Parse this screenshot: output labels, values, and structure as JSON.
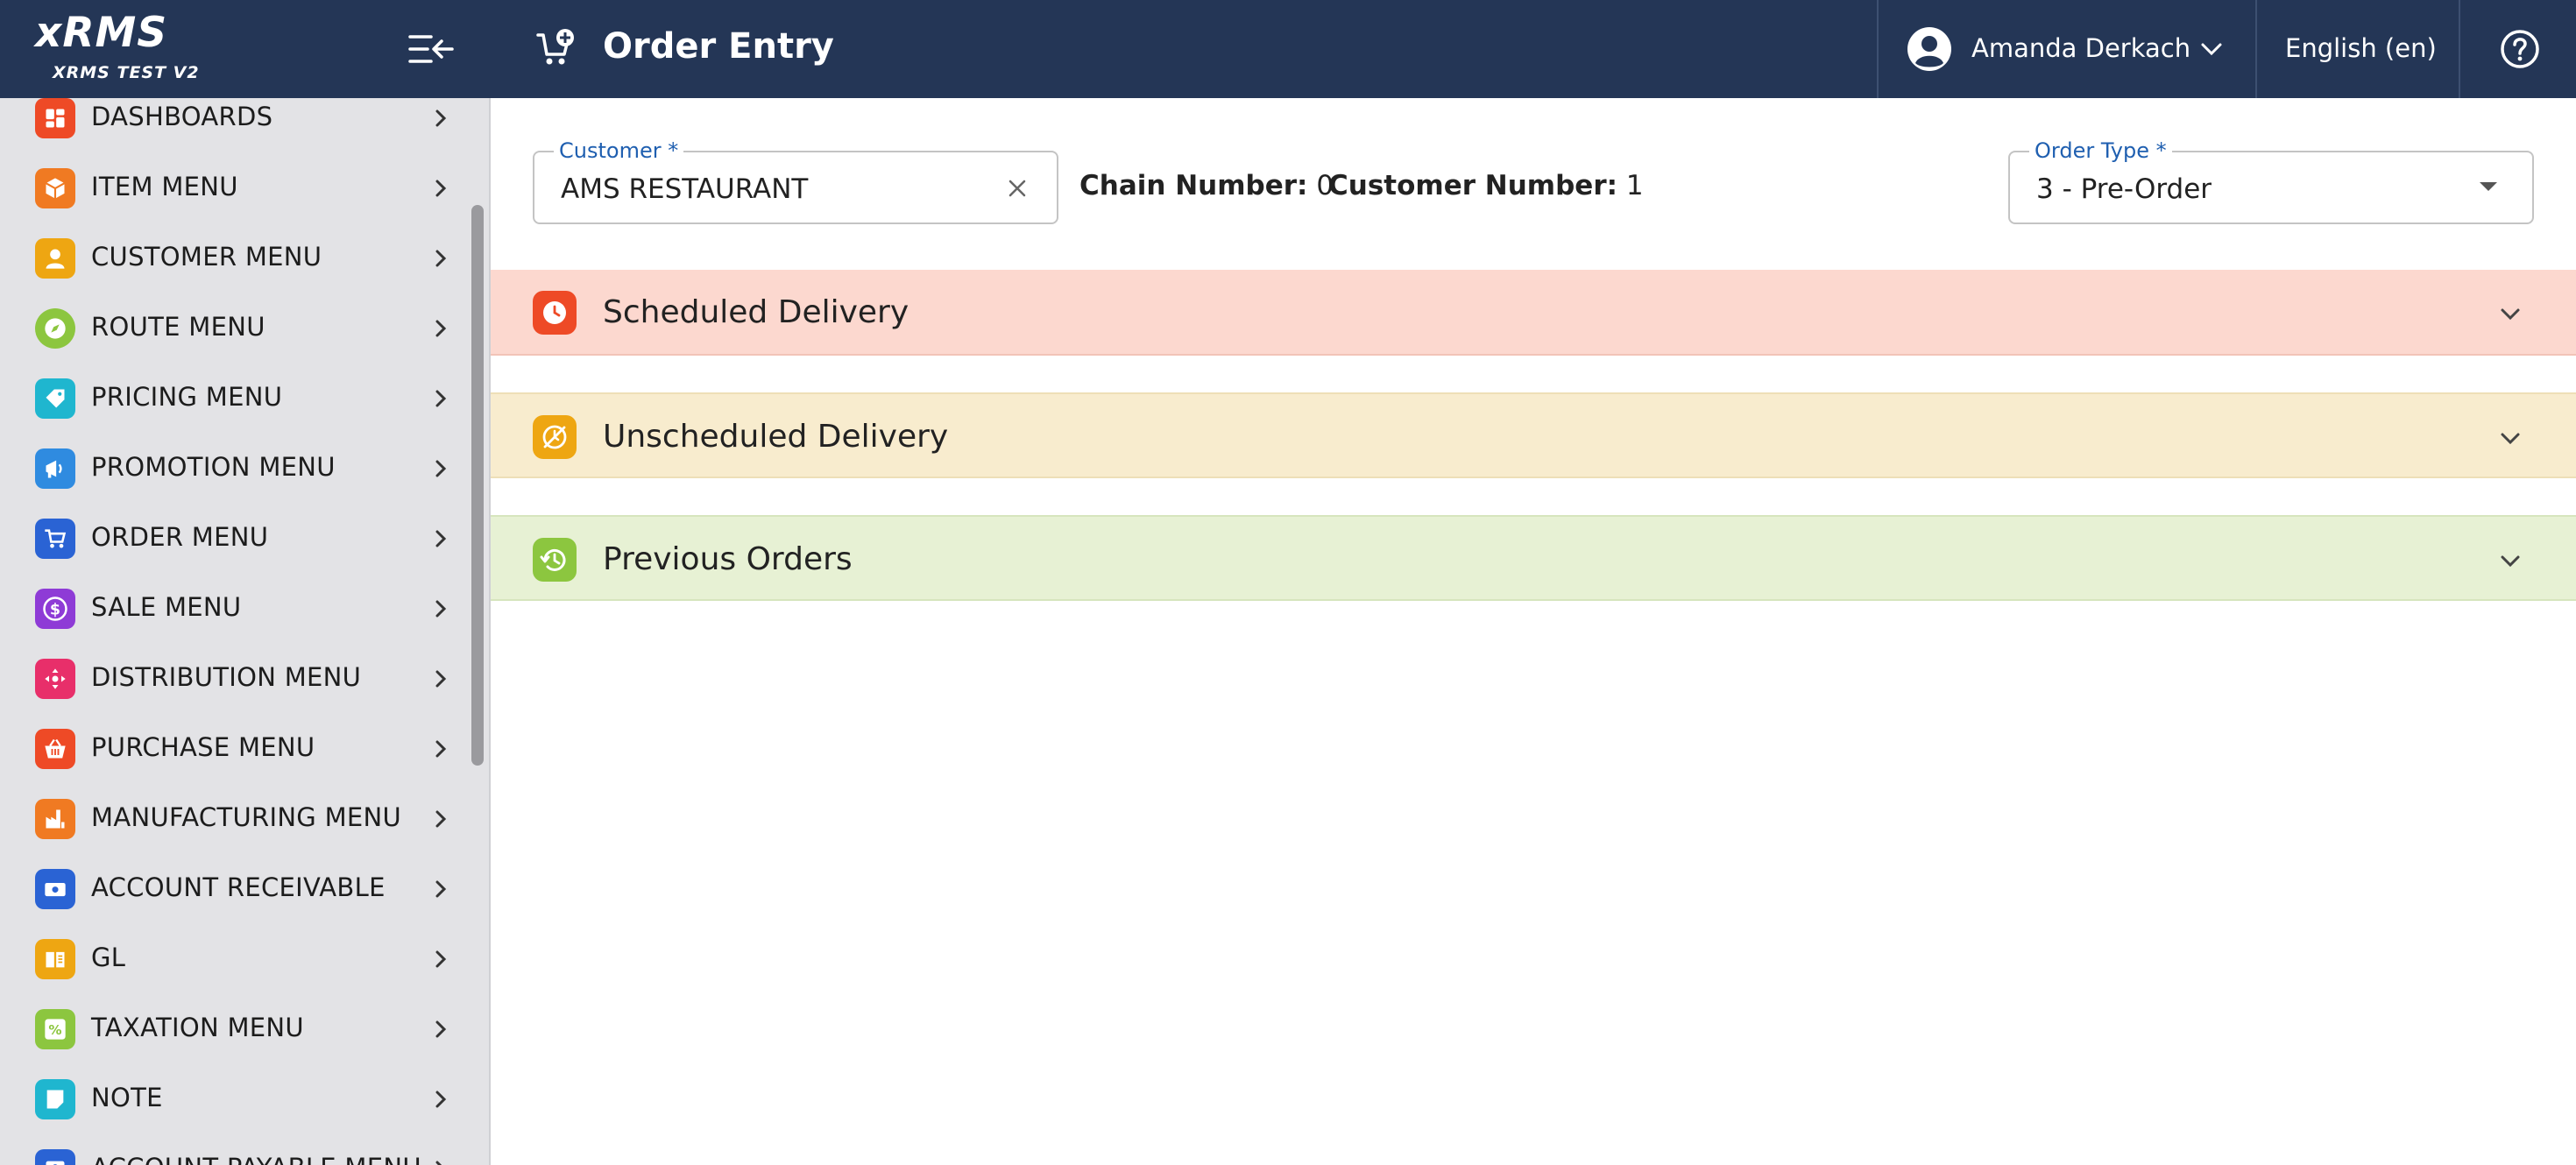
{
  "brand": {
    "title": "xRMS",
    "subtitle": "XRMS TEST V2"
  },
  "sidebar": {
    "items": [
      {
        "label": "DASHBOARDS",
        "icon": "dashboard-icon",
        "color": "#ee4a26"
      },
      {
        "label": "ITEM MENU",
        "icon": "box-icon",
        "color": "#f07a22"
      },
      {
        "label": "CUSTOMER MENU",
        "icon": "person-icon",
        "color": "#eea612"
      },
      {
        "label": "ROUTE MENU",
        "icon": "compass-icon",
        "color": "#8cc63f"
      },
      {
        "label": "PRICING MENU",
        "icon": "price-tag-icon",
        "color": "#1fb6cf"
      },
      {
        "label": "PROMOTION MENU",
        "icon": "megaphone-icon",
        "color": "#2f8be0"
      },
      {
        "label": "ORDER MENU",
        "icon": "cart-icon",
        "color": "#2a63d4"
      },
      {
        "label": "SALE MENU",
        "icon": "dollar-icon",
        "color": "#8e3bd6"
      },
      {
        "label": "DISTRIBUTION MENU",
        "icon": "distribution-icon",
        "color": "#e82f6a"
      },
      {
        "label": "PURCHASE MENU",
        "icon": "basket-icon",
        "color": "#ee4a26"
      },
      {
        "label": "MANUFACTURING MENU",
        "icon": "factory-icon",
        "color": "#f07a22"
      },
      {
        "label": "ACCOUNT RECEIVABLE",
        "icon": "money-icon",
        "color": "#2a63d4"
      },
      {
        "label": "GL",
        "icon": "ledger-icon",
        "color": "#eea612"
      },
      {
        "label": "TAXATION MENU",
        "icon": "percent-icon",
        "color": "#8cc63f"
      },
      {
        "label": "NOTE",
        "icon": "note-icon",
        "color": "#1fb6cf"
      },
      {
        "label": "ACCOUNT PAYABLE MENU",
        "icon": "payable-icon",
        "color": "#2a63d4"
      }
    ]
  },
  "header": {
    "title": "Order Entry",
    "user_name": "Amanda Derkach",
    "language": "English (en)"
  },
  "form": {
    "customer_label": "Customer *",
    "customer_value": "AMS RESTAURANT",
    "chain_label": "Chain Number:",
    "chain_value": "0",
    "customer_number_label": "Customer Number:",
    "customer_number_value": "1",
    "order_type_label": "Order Type *",
    "order_type_value": "3 - Pre-Order"
  },
  "panels": [
    {
      "title": "Scheduled Delivery",
      "icon": "clock-icon",
      "color": "#ee4a26"
    },
    {
      "title": "Unscheduled Delivery",
      "icon": "no-schedule-icon",
      "color": "#eea612"
    },
    {
      "title": "Previous Orders",
      "icon": "history-icon",
      "color": "#8cc63f"
    }
  ],
  "colors": {
    "header_bg": "#243656",
    "sidebar_bg": "#e3e3e6",
    "accent": "#1f5fb0"
  }
}
